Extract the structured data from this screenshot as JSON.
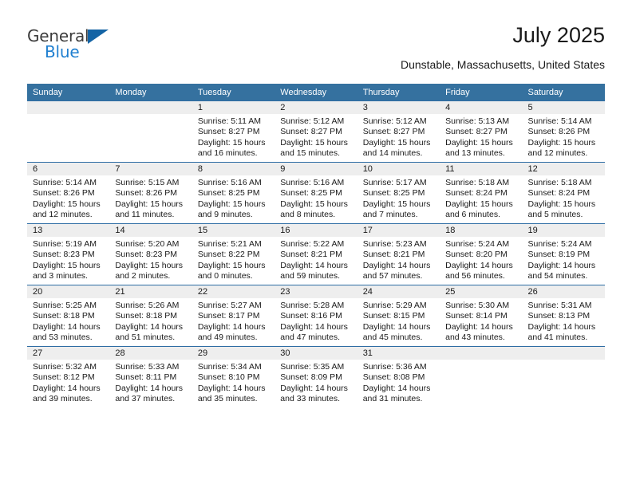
{
  "brand": {
    "line1": "General",
    "line2": "Blue",
    "triangle_color": "#1464a5",
    "blue_color": "#1f7fd0"
  },
  "header": {
    "title": "July 2025",
    "location": "Dunstable, Massachusetts, United States"
  },
  "theme": {
    "header_bg": "#35719f",
    "row_divider": "#2e6da4",
    "daynum_bg": "#eeeeee"
  },
  "weekday_headers": [
    "Sunday",
    "Monday",
    "Tuesday",
    "Wednesday",
    "Thursday",
    "Friday",
    "Saturday"
  ],
  "labels": {
    "sunrise_prefix": "Sunrise:",
    "sunset_prefix": "Sunset:",
    "daylight_prefix": "Daylight:"
  },
  "weeks": [
    [
      {
        "day": "",
        "sunrise": "",
        "sunset": "",
        "daylight_l1": "",
        "daylight_l2": ""
      },
      {
        "day": "",
        "sunrise": "",
        "sunset": "",
        "daylight_l1": "",
        "daylight_l2": ""
      },
      {
        "day": "1",
        "sunrise": "Sunrise: 5:11 AM",
        "sunset": "Sunset: 8:27 PM",
        "daylight_l1": "Daylight: 15 hours",
        "daylight_l2": "and 16 minutes."
      },
      {
        "day": "2",
        "sunrise": "Sunrise: 5:12 AM",
        "sunset": "Sunset: 8:27 PM",
        "daylight_l1": "Daylight: 15 hours",
        "daylight_l2": "and 15 minutes."
      },
      {
        "day": "3",
        "sunrise": "Sunrise: 5:12 AM",
        "sunset": "Sunset: 8:27 PM",
        "daylight_l1": "Daylight: 15 hours",
        "daylight_l2": "and 14 minutes."
      },
      {
        "day": "4",
        "sunrise": "Sunrise: 5:13 AM",
        "sunset": "Sunset: 8:27 PM",
        "daylight_l1": "Daylight: 15 hours",
        "daylight_l2": "and 13 minutes."
      },
      {
        "day": "5",
        "sunrise": "Sunrise: 5:14 AM",
        "sunset": "Sunset: 8:26 PM",
        "daylight_l1": "Daylight: 15 hours",
        "daylight_l2": "and 12 minutes."
      }
    ],
    [
      {
        "day": "6",
        "sunrise": "Sunrise: 5:14 AM",
        "sunset": "Sunset: 8:26 PM",
        "daylight_l1": "Daylight: 15 hours",
        "daylight_l2": "and 12 minutes."
      },
      {
        "day": "7",
        "sunrise": "Sunrise: 5:15 AM",
        "sunset": "Sunset: 8:26 PM",
        "daylight_l1": "Daylight: 15 hours",
        "daylight_l2": "and 11 minutes."
      },
      {
        "day": "8",
        "sunrise": "Sunrise: 5:16 AM",
        "sunset": "Sunset: 8:25 PM",
        "daylight_l1": "Daylight: 15 hours",
        "daylight_l2": "and 9 minutes."
      },
      {
        "day": "9",
        "sunrise": "Sunrise: 5:16 AM",
        "sunset": "Sunset: 8:25 PM",
        "daylight_l1": "Daylight: 15 hours",
        "daylight_l2": "and 8 minutes."
      },
      {
        "day": "10",
        "sunrise": "Sunrise: 5:17 AM",
        "sunset": "Sunset: 8:25 PM",
        "daylight_l1": "Daylight: 15 hours",
        "daylight_l2": "and 7 minutes."
      },
      {
        "day": "11",
        "sunrise": "Sunrise: 5:18 AM",
        "sunset": "Sunset: 8:24 PM",
        "daylight_l1": "Daylight: 15 hours",
        "daylight_l2": "and 6 minutes."
      },
      {
        "day": "12",
        "sunrise": "Sunrise: 5:18 AM",
        "sunset": "Sunset: 8:24 PM",
        "daylight_l1": "Daylight: 15 hours",
        "daylight_l2": "and 5 minutes."
      }
    ],
    [
      {
        "day": "13",
        "sunrise": "Sunrise: 5:19 AM",
        "sunset": "Sunset: 8:23 PM",
        "daylight_l1": "Daylight: 15 hours",
        "daylight_l2": "and 3 minutes."
      },
      {
        "day": "14",
        "sunrise": "Sunrise: 5:20 AM",
        "sunset": "Sunset: 8:23 PM",
        "daylight_l1": "Daylight: 15 hours",
        "daylight_l2": "and 2 minutes."
      },
      {
        "day": "15",
        "sunrise": "Sunrise: 5:21 AM",
        "sunset": "Sunset: 8:22 PM",
        "daylight_l1": "Daylight: 15 hours",
        "daylight_l2": "and 0 minutes."
      },
      {
        "day": "16",
        "sunrise": "Sunrise: 5:22 AM",
        "sunset": "Sunset: 8:21 PM",
        "daylight_l1": "Daylight: 14 hours",
        "daylight_l2": "and 59 minutes."
      },
      {
        "day": "17",
        "sunrise": "Sunrise: 5:23 AM",
        "sunset": "Sunset: 8:21 PM",
        "daylight_l1": "Daylight: 14 hours",
        "daylight_l2": "and 57 minutes."
      },
      {
        "day": "18",
        "sunrise": "Sunrise: 5:24 AM",
        "sunset": "Sunset: 8:20 PM",
        "daylight_l1": "Daylight: 14 hours",
        "daylight_l2": "and 56 minutes."
      },
      {
        "day": "19",
        "sunrise": "Sunrise: 5:24 AM",
        "sunset": "Sunset: 8:19 PM",
        "daylight_l1": "Daylight: 14 hours",
        "daylight_l2": "and 54 minutes."
      }
    ],
    [
      {
        "day": "20",
        "sunrise": "Sunrise: 5:25 AM",
        "sunset": "Sunset: 8:18 PM",
        "daylight_l1": "Daylight: 14 hours",
        "daylight_l2": "and 53 minutes."
      },
      {
        "day": "21",
        "sunrise": "Sunrise: 5:26 AM",
        "sunset": "Sunset: 8:18 PM",
        "daylight_l1": "Daylight: 14 hours",
        "daylight_l2": "and 51 minutes."
      },
      {
        "day": "22",
        "sunrise": "Sunrise: 5:27 AM",
        "sunset": "Sunset: 8:17 PM",
        "daylight_l1": "Daylight: 14 hours",
        "daylight_l2": "and 49 minutes."
      },
      {
        "day": "23",
        "sunrise": "Sunrise: 5:28 AM",
        "sunset": "Sunset: 8:16 PM",
        "daylight_l1": "Daylight: 14 hours",
        "daylight_l2": "and 47 minutes."
      },
      {
        "day": "24",
        "sunrise": "Sunrise: 5:29 AM",
        "sunset": "Sunset: 8:15 PM",
        "daylight_l1": "Daylight: 14 hours",
        "daylight_l2": "and 45 minutes."
      },
      {
        "day": "25",
        "sunrise": "Sunrise: 5:30 AM",
        "sunset": "Sunset: 8:14 PM",
        "daylight_l1": "Daylight: 14 hours",
        "daylight_l2": "and 43 minutes."
      },
      {
        "day": "26",
        "sunrise": "Sunrise: 5:31 AM",
        "sunset": "Sunset: 8:13 PM",
        "daylight_l1": "Daylight: 14 hours",
        "daylight_l2": "and 41 minutes."
      }
    ],
    [
      {
        "day": "27",
        "sunrise": "Sunrise: 5:32 AM",
        "sunset": "Sunset: 8:12 PM",
        "daylight_l1": "Daylight: 14 hours",
        "daylight_l2": "and 39 minutes."
      },
      {
        "day": "28",
        "sunrise": "Sunrise: 5:33 AM",
        "sunset": "Sunset: 8:11 PM",
        "daylight_l1": "Daylight: 14 hours",
        "daylight_l2": "and 37 minutes."
      },
      {
        "day": "29",
        "sunrise": "Sunrise: 5:34 AM",
        "sunset": "Sunset: 8:10 PM",
        "daylight_l1": "Daylight: 14 hours",
        "daylight_l2": "and 35 minutes."
      },
      {
        "day": "30",
        "sunrise": "Sunrise: 5:35 AM",
        "sunset": "Sunset: 8:09 PM",
        "daylight_l1": "Daylight: 14 hours",
        "daylight_l2": "and 33 minutes."
      },
      {
        "day": "31",
        "sunrise": "Sunrise: 5:36 AM",
        "sunset": "Sunset: 8:08 PM",
        "daylight_l1": "Daylight: 14 hours",
        "daylight_l2": "and 31 minutes."
      },
      {
        "day": "",
        "sunrise": "",
        "sunset": "",
        "daylight_l1": "",
        "daylight_l2": ""
      },
      {
        "day": "",
        "sunrise": "",
        "sunset": "",
        "daylight_l1": "",
        "daylight_l2": ""
      }
    ]
  ]
}
